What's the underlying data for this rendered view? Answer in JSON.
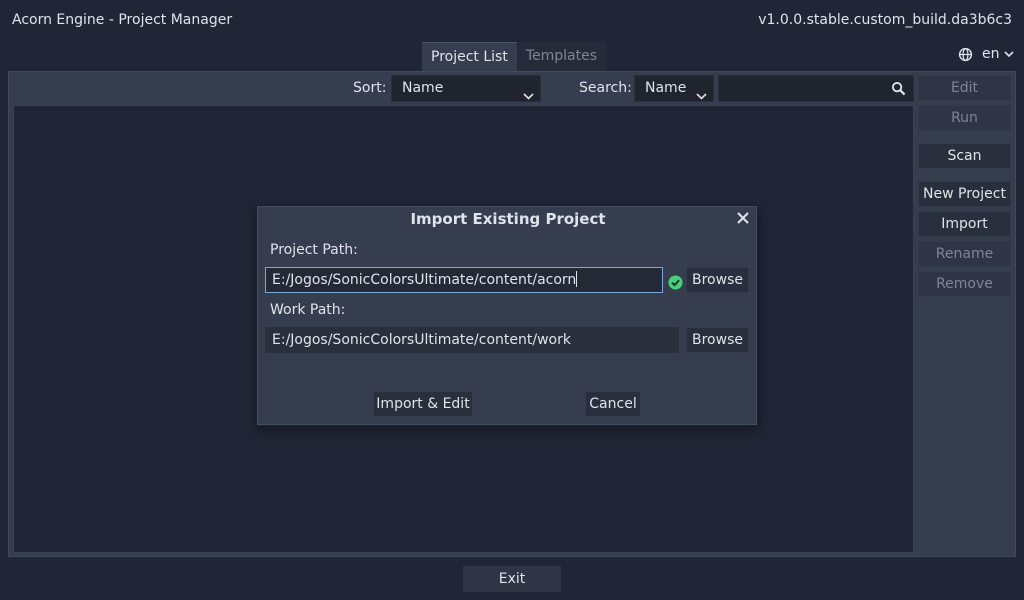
{
  "window": {
    "title": "Acorn Engine - Project Manager",
    "version": "v1.0.0.stable.custom_build.da3b6c3"
  },
  "tabs": [
    {
      "label": "Project List",
      "active": true
    },
    {
      "label": "Templates",
      "active": false
    }
  ],
  "language": {
    "icon": "globe-icon",
    "value": "en"
  },
  "toolbar": {
    "sort_label": "Sort:",
    "sort_value": "Name",
    "search_label": "Search:",
    "search_by_value": "Name",
    "search_value": ""
  },
  "side_buttons": {
    "edit": "Edit",
    "run": "Run",
    "scan": "Scan",
    "new_project": "New Project",
    "import": "Import",
    "rename": "Rename",
    "remove": "Remove"
  },
  "footer": {
    "exit": "Exit"
  },
  "dialog": {
    "title": "Import Existing Project",
    "project_path_label": "Project Path:",
    "project_path_value": "E:/Jogos/SonicColorsUltimate/content/acorn",
    "work_path_label": "Work Path:",
    "work_path_value": "E:/Jogos/SonicColorsUltimate/content/work",
    "browse_label": "Browse",
    "import_edit_label": "Import & Edit",
    "cancel_label": "Cancel"
  },
  "colors": {
    "background": "#212636",
    "panel": "#363d4f",
    "valid_check": "#45d07a",
    "focus_border": "#7ba6e0"
  }
}
